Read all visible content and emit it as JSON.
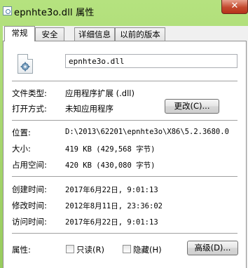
{
  "window": {
    "title": "epnhte3o.dll 属性",
    "close_glyph": "✕"
  },
  "tabs": [
    {
      "label": "常规",
      "active": true
    },
    {
      "label": "安全",
      "active": false
    },
    {
      "label": "详细信息",
      "active": false
    },
    {
      "label": "以前的版本",
      "active": false
    }
  ],
  "general": {
    "file_icon": "dll-file-gear-icon",
    "file_name": "epnhte3o.dll",
    "file_type_label": "文件类型:",
    "file_type_value": "应用程序扩展 (.dll)",
    "opens_with_label": "打开方式:",
    "opens_with_value": "未知应用程序",
    "change_button": "更改(C)...",
    "location_label": "位置:",
    "location_value": "D:\\2013\\62201\\epnhte3o\\X86\\5.2.3680.0",
    "size_label": "大小:",
    "size_value": "419 KB (429,568 字节)",
    "size_on_disk_label": "占用空间:",
    "size_on_disk_value": "420 KB (430,080 字节)",
    "created_label": "创建时间:",
    "created_value": "2017年6月22日, 9:01:13",
    "modified_label": "修改时间:",
    "modified_value": "2012年8月11日, 23:36:02",
    "accessed_label": "访问时间:",
    "accessed_value": "2017年6月22日, 9:01:13",
    "attributes_label": "属性:",
    "readonly_label": "只读(R)",
    "hidden_label": "隐藏(H)",
    "advanced_button": "高级(D)..."
  }
}
